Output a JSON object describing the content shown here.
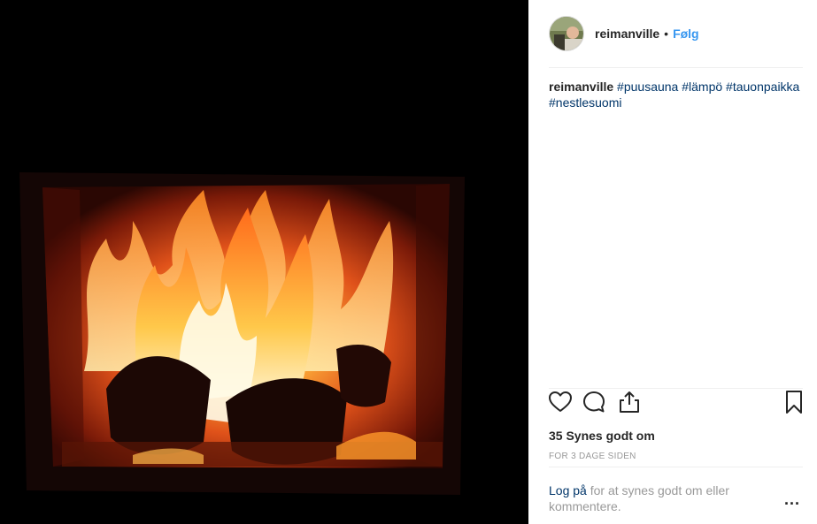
{
  "post": {
    "image_alt": "Fire burning in a sauna stove",
    "header": {
      "username": "reimanville",
      "separator": "•",
      "follow_label": "Følg"
    },
    "caption": {
      "username": "reimanville",
      "hashtags": [
        "#puusauna",
        "#lämpö",
        "#tauonpaikka",
        "#nestlesuomi"
      ]
    },
    "actions": {
      "like_icon": "heart-icon",
      "comment_icon": "comment-icon",
      "share_icon": "share-icon",
      "save_icon": "bookmark-icon"
    },
    "likes_text": "35 Synes godt om",
    "timestamp": "FOR 3 DAGE SIDEN",
    "login": {
      "link_text": "Log på",
      "rest_text": " for at synes godt om eller kommentere."
    },
    "more_label": "..."
  },
  "colors": {
    "link_blue": "#3897f0",
    "hashtag_blue": "#003569",
    "muted": "#999999",
    "text": "#262626",
    "divider": "#efefef"
  }
}
